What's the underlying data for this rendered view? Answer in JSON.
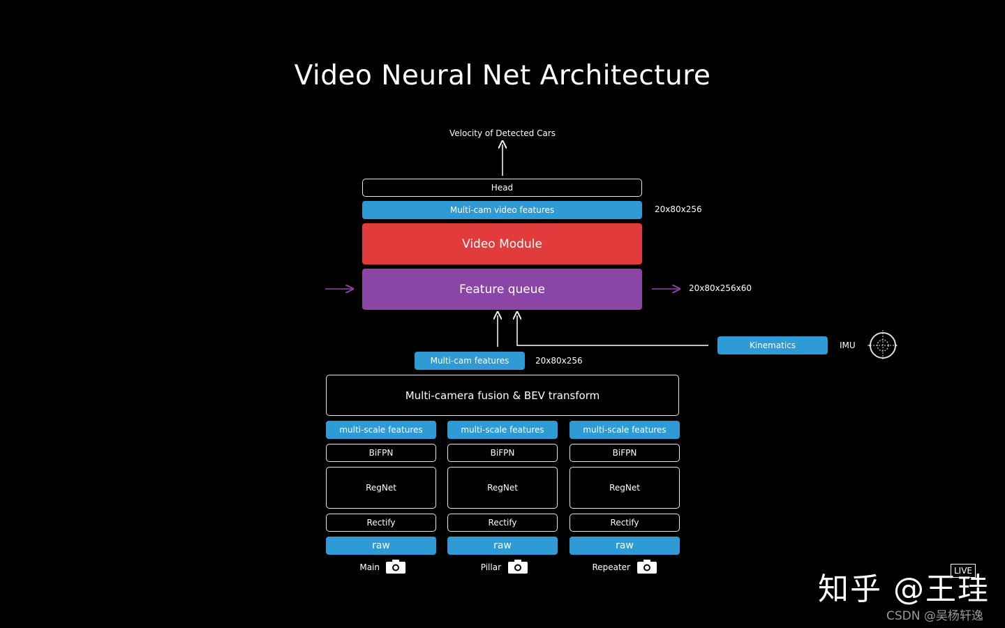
{
  "title": "Video Neural Net Architecture",
  "output_label": "Velocity of Detected Cars",
  "head_label": "Head",
  "video_features_label": "Multi-cam video features",
  "video_features_dim": "20x80x256",
  "video_module_label": "Video Module",
  "feature_queue_label": "Feature queue",
  "feature_queue_dim": "20x80x256x60",
  "kinematics_label": "Kinematics",
  "imu_label": "IMU",
  "multicam_features_label": "Multi-cam features",
  "multicam_features_dim": "20x80x256",
  "fusion_label": "Multi-camera fusion & BEV transform",
  "columns": [
    {
      "features": "multi-scale features",
      "bifpn": "BiFPN",
      "regnet": "RegNet",
      "rectify": "Rectify",
      "raw": "raw",
      "camera": "Main"
    },
    {
      "features": "multi-scale features",
      "bifpn": "BiFPN",
      "regnet": "RegNet",
      "rectify": "Rectify",
      "raw": "raw",
      "camera": "Pillar"
    },
    {
      "features": "multi-scale features",
      "bifpn": "BiFPN",
      "regnet": "RegNet",
      "rectify": "Rectify",
      "raw": "raw",
      "camera": "Repeater"
    }
  ],
  "watermark": {
    "main": "知乎 @王珪",
    "live": "LIVE",
    "small": "CSDN @吴杨轩逸"
  },
  "colors": {
    "blue": "#2e9bd6",
    "red": "#e23b3b",
    "purple": "#8a45a6",
    "background": "#000000"
  }
}
